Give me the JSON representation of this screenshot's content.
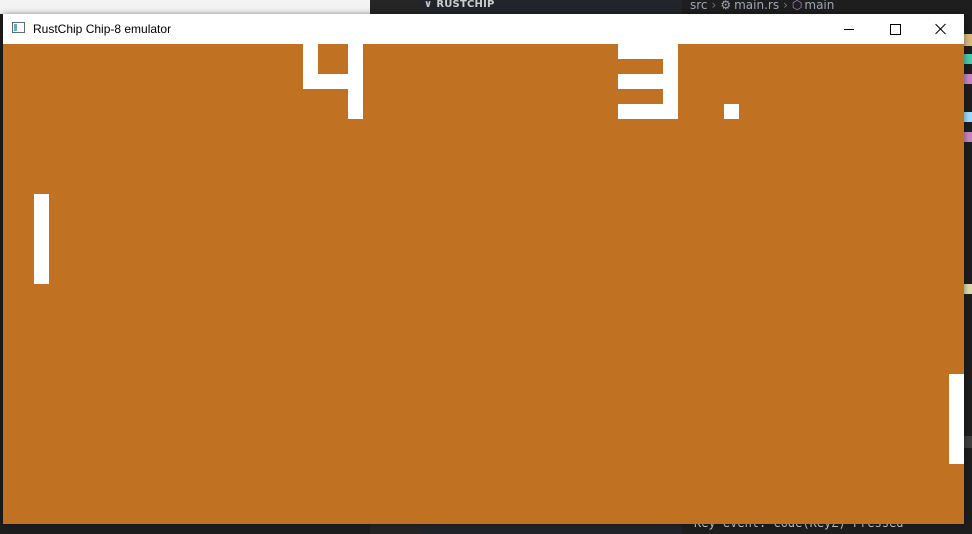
{
  "background_editor": {
    "explorer_title": "RUSTCHIP",
    "breadcrumb": {
      "folder": "src",
      "file": "main.rs",
      "symbol": "main"
    },
    "terminal_text": "Key event: Code(KeyZ) Pressed"
  },
  "window": {
    "title": "RustChip Chip-8 emulator",
    "controls": {
      "minimize": "minimize-icon",
      "maximize": "maximize-icon",
      "close": "close-icon"
    }
  },
  "game": {
    "score_left": "4",
    "score_right": "3",
    "colors": {
      "background": "#c07222",
      "foreground": "#ffffff"
    }
  }
}
